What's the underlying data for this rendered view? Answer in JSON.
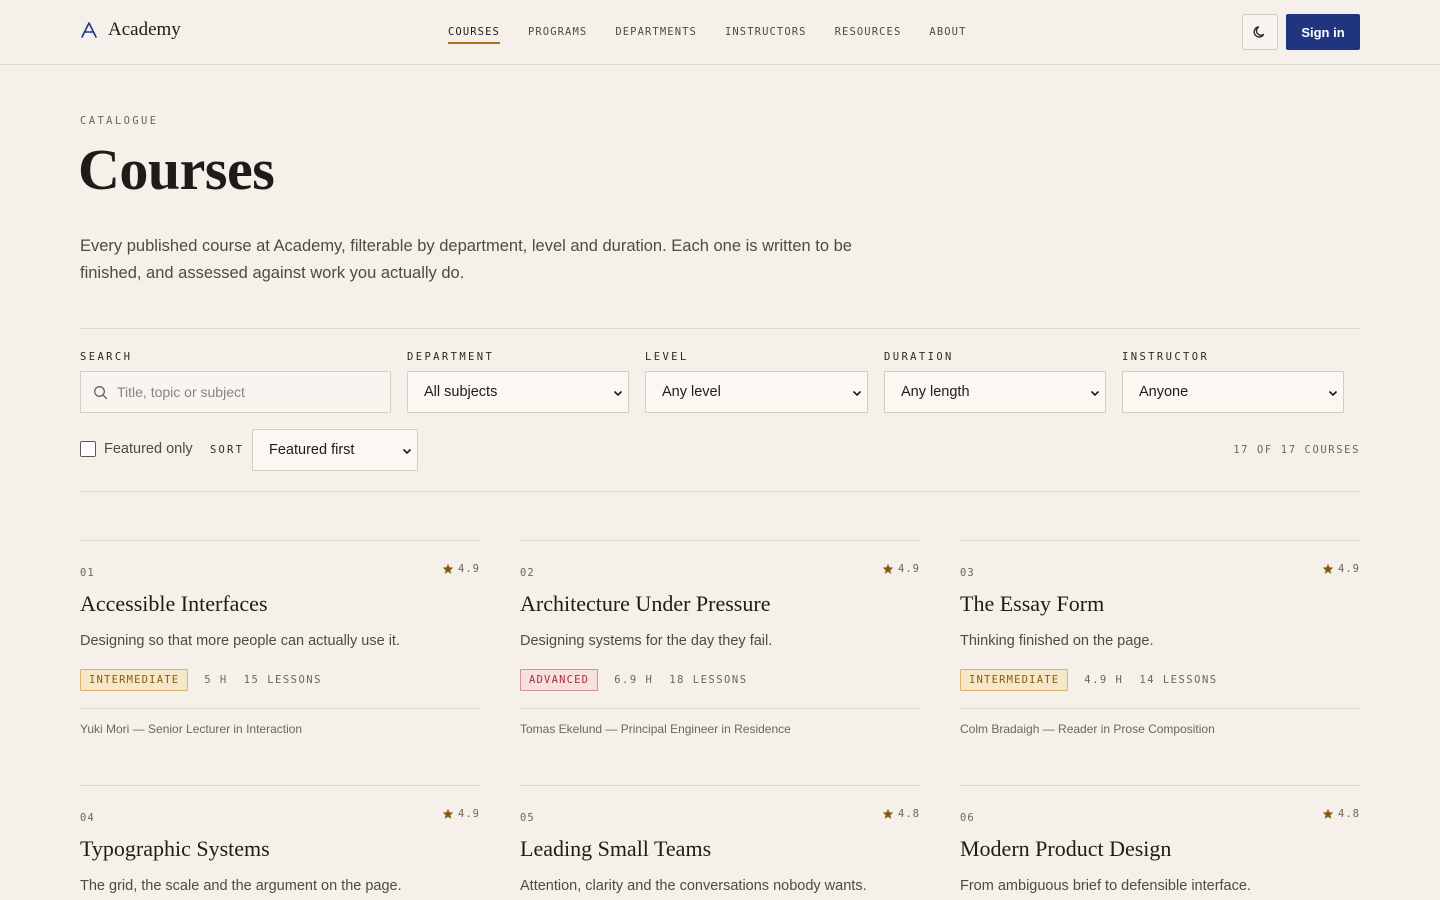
{
  "brand": {
    "name": "Academy",
    "logo_icon": "triangle-a-icon"
  },
  "nav": {
    "items": [
      {
        "label": "COURSES",
        "active": true
      },
      {
        "label": "PROGRAMS",
        "active": false
      },
      {
        "label": "DEPARTMENTS",
        "active": false
      },
      {
        "label": "INSTRUCTORS",
        "active": false
      },
      {
        "label": "RESOURCES",
        "active": false
      },
      {
        "label": "ABOUT",
        "active": false
      }
    ],
    "theme_icon": "moon-icon",
    "signin_label": "Sign in"
  },
  "hero": {
    "eyebrow": "CATALOGUE",
    "title": "Courses",
    "intro": "Every published course at Academy, filterable by department, level and duration. Each one is written to be finished, and assessed against work you actually do."
  },
  "filters": {
    "search": {
      "label": "SEARCH",
      "placeholder": "Title, topic or subject",
      "value": ""
    },
    "department": {
      "label": "DEPARTMENT",
      "value": "All subjects"
    },
    "level": {
      "label": "LEVEL",
      "value": "Any level"
    },
    "duration": {
      "label": "DURATION",
      "value": "Any length"
    },
    "instructor": {
      "label": "INSTRUCTOR",
      "value": "Anyone"
    },
    "featured_only": {
      "label": "Featured only",
      "checked": false
    },
    "sort": {
      "label": "SORT",
      "value": "Featured first"
    },
    "count": "17 OF 17 COURSES"
  },
  "courses": [
    {
      "num": "01",
      "rating": "4.9",
      "title": "Accessible Interfaces",
      "desc": "Designing so that more people can actually use it.",
      "level": "INTERMEDIATE",
      "level_key": "intermediate",
      "hours": "5 H",
      "lessons": "15 LESSONS",
      "instructor": "Yuki Mori — Senior Lecturer in Interaction"
    },
    {
      "num": "02",
      "rating": "4.9",
      "title": "Architecture Under Pressure",
      "desc": "Designing systems for the day they fail.",
      "level": "ADVANCED",
      "level_key": "advanced",
      "hours": "6.9 H",
      "lessons": "18 LESSONS",
      "instructor": "Tomas Ekelund — Principal Engineer in Residence"
    },
    {
      "num": "03",
      "rating": "4.9",
      "title": "The Essay Form",
      "desc": "Thinking finished on the page.",
      "level": "INTERMEDIATE",
      "level_key": "intermediate",
      "hours": "4.9 H",
      "lessons": "14 LESSONS",
      "instructor": "Colm Bradaigh — Reader in Prose Composition"
    },
    {
      "num": "04",
      "rating": "4.9",
      "title": "Typographic Systems",
      "desc": "The grid, the scale and the argument on the page."
    },
    {
      "num": "05",
      "rating": "4.8",
      "title": "Leading Small Teams",
      "desc": "Attention, clarity and the conversations nobody wants."
    },
    {
      "num": "06",
      "rating": "4.8",
      "title": "Modern Product Design",
      "desc": "From ambiguous brief to defensible interface."
    }
  ],
  "colors": {
    "accent": "#1f3580",
    "nav_active": "#a8731d",
    "star": "#8a5c12"
  }
}
